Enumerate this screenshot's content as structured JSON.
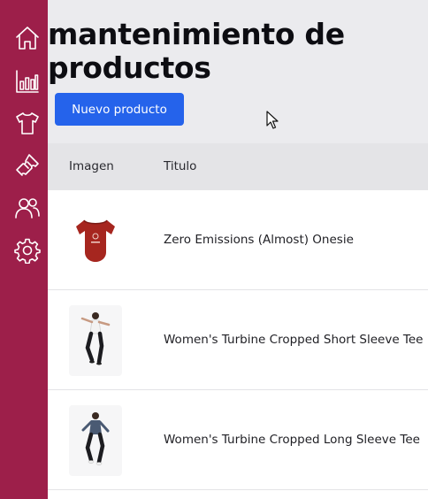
{
  "sidebar": {
    "items": [
      {
        "icon": "home-icon"
      },
      {
        "icon": "chart-icon"
      },
      {
        "icon": "shirt-icon"
      },
      {
        "icon": "ticket-icon"
      },
      {
        "icon": "users-icon"
      },
      {
        "icon": "gear-icon"
      }
    ],
    "color": "#9d1f4a"
  },
  "header": {
    "title": "mantenimiento de productos",
    "new_button_label": "Nuevo producto",
    "button_color": "#2563eb"
  },
  "table": {
    "columns": [
      "Imagen",
      "Titulo"
    ],
    "rows": [
      {
        "title": "Zero Emissions (Almost) Onesie",
        "image": "red-onesie"
      },
      {
        "title": "Women's Turbine Cropped Short Sleeve Tee",
        "image": "woman-jumping-white-top"
      },
      {
        "title": "Women's Turbine Cropped Long Sleeve Tee",
        "image": "woman-jumping-gray-top"
      }
    ]
  }
}
